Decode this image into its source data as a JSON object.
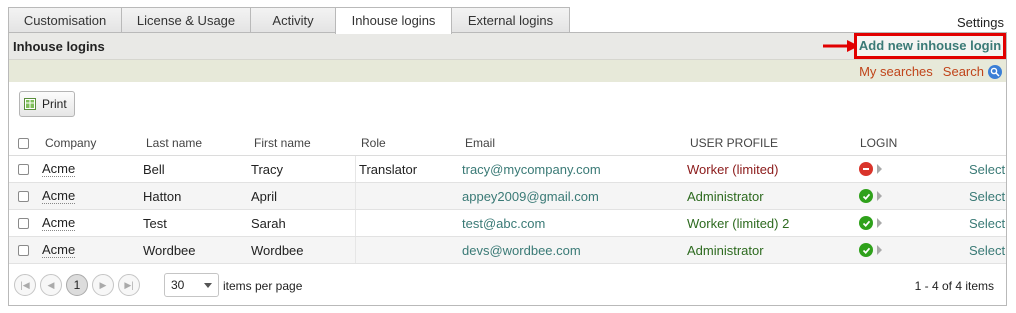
{
  "tabs": [
    {
      "label": "Customisation"
    },
    {
      "label": "License & Usage"
    },
    {
      "label": "Activity"
    },
    {
      "label": "Inhouse logins"
    },
    {
      "label": "External logins"
    }
  ],
  "settings_label": "Settings",
  "panel": {
    "title": "Inhouse logins",
    "add_button": "Add new inhouse login",
    "my_searches": "My searches",
    "search": "Search",
    "print": "Print"
  },
  "table": {
    "headers": {
      "company": "Company",
      "last_name": "Last name",
      "first_name": "First name",
      "role": "Role",
      "email": "Email",
      "user_profile": "USER PROFILE",
      "login": "LOGIN"
    },
    "rows": [
      {
        "company": "Acme",
        "last_name": "Bell",
        "first_name": "Tracy",
        "role": "Translator",
        "email": "tracy@mycompany.com",
        "profile": "Worker (limited)",
        "login": "blocked",
        "action": "Select"
      },
      {
        "company": "Acme",
        "last_name": "Hatton",
        "first_name": "April",
        "role": "",
        "email": "appey2009@gmail.com",
        "profile": "Administrator",
        "login": "enabled",
        "action": "Select"
      },
      {
        "company": "Acme",
        "last_name": "Test",
        "first_name": "Sarah",
        "role": "",
        "email": "test@abc.com",
        "profile": "Worker (limited) 2",
        "login": "enabled",
        "action": "Select"
      },
      {
        "company": "Acme",
        "last_name": "Wordbee",
        "first_name": "Wordbee",
        "role": "",
        "email": "devs@wordbee.com",
        "profile": "Administrator",
        "login": "enabled",
        "action": "Select"
      }
    ]
  },
  "pager": {
    "current_page": "1",
    "page_size": "30",
    "per_page_label": "items per page",
    "range_label": "1 - 4 of 4 items"
  },
  "colors": {
    "accent_teal": "#3a7a76",
    "highlight_red": "#e10000",
    "link_orange": "#c0441a"
  }
}
